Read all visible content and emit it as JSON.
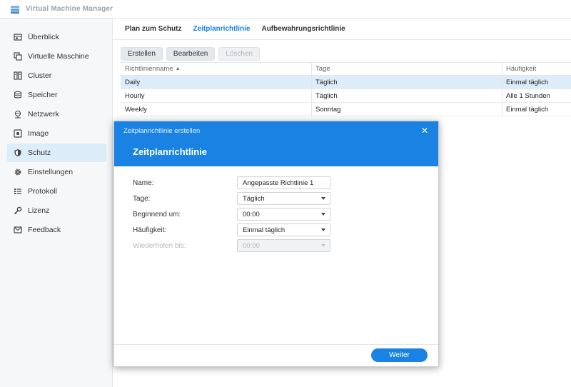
{
  "app": {
    "title": "Virtual Machine Manager"
  },
  "sidebar": {
    "items": [
      {
        "label": "Überblick",
        "icon": "overview-icon"
      },
      {
        "label": "Virtuelle Maschine",
        "icon": "virtual-machine-icon"
      },
      {
        "label": "Cluster",
        "icon": "cluster-icon"
      },
      {
        "label": "Speicher",
        "icon": "storage-icon"
      },
      {
        "label": "Netzwerk",
        "icon": "network-icon"
      },
      {
        "label": "Image",
        "icon": "image-icon"
      },
      {
        "label": "Schutz",
        "icon": "shield-icon",
        "active": true
      },
      {
        "label": "Einstellungen",
        "icon": "gear-icon"
      },
      {
        "label": "Protokoll",
        "icon": "log-icon"
      },
      {
        "label": "Lizenz",
        "icon": "key-icon"
      },
      {
        "label": "Feedback",
        "icon": "feedback-icon"
      }
    ]
  },
  "tabs": [
    {
      "label": "Plan zum Schutz"
    },
    {
      "label": "Zeitplanrichtlinie",
      "active": true
    },
    {
      "label": "Aufbewahrungsrichtlinie"
    }
  ],
  "toolbar": {
    "create": "Erstellen",
    "edit": "Bearbeiten",
    "delete": "Löschen"
  },
  "table": {
    "columns": [
      "Richtlinienname",
      "Tage",
      "Häufigkeit"
    ],
    "sort_indicator": "▲",
    "rows": [
      [
        "Daily",
        "Täglich",
        "Einmal täglich"
      ],
      [
        "Hourly",
        "Täglich",
        "Alle 1 Stunden"
      ],
      [
        "Weekly",
        "Sonntag",
        "Einmal täglich"
      ]
    ]
  },
  "dialog": {
    "window_title": "Zeitplanrichtlinie erstellen",
    "heading": "Zeitplanrichtlinie",
    "close_symbol": "✕",
    "fields": {
      "name": {
        "label": "Name:",
        "value": "Angepasste Richtlinie 1"
      },
      "days": {
        "label": "Tage:",
        "value": "Täglich"
      },
      "start": {
        "label": "Beginnend um:",
        "value": "00:00"
      },
      "frequency": {
        "label": "Häufigkeit:",
        "value": "Einmal täglich"
      },
      "repeat_until": {
        "label": "Wiederholen bis:",
        "value": "00:00"
      }
    },
    "next_button": "Weiter"
  },
  "colors": {
    "accent": "#1a82e2",
    "selected_row": "#dcecf8",
    "sidebar_bg": "#f6f7f8"
  }
}
